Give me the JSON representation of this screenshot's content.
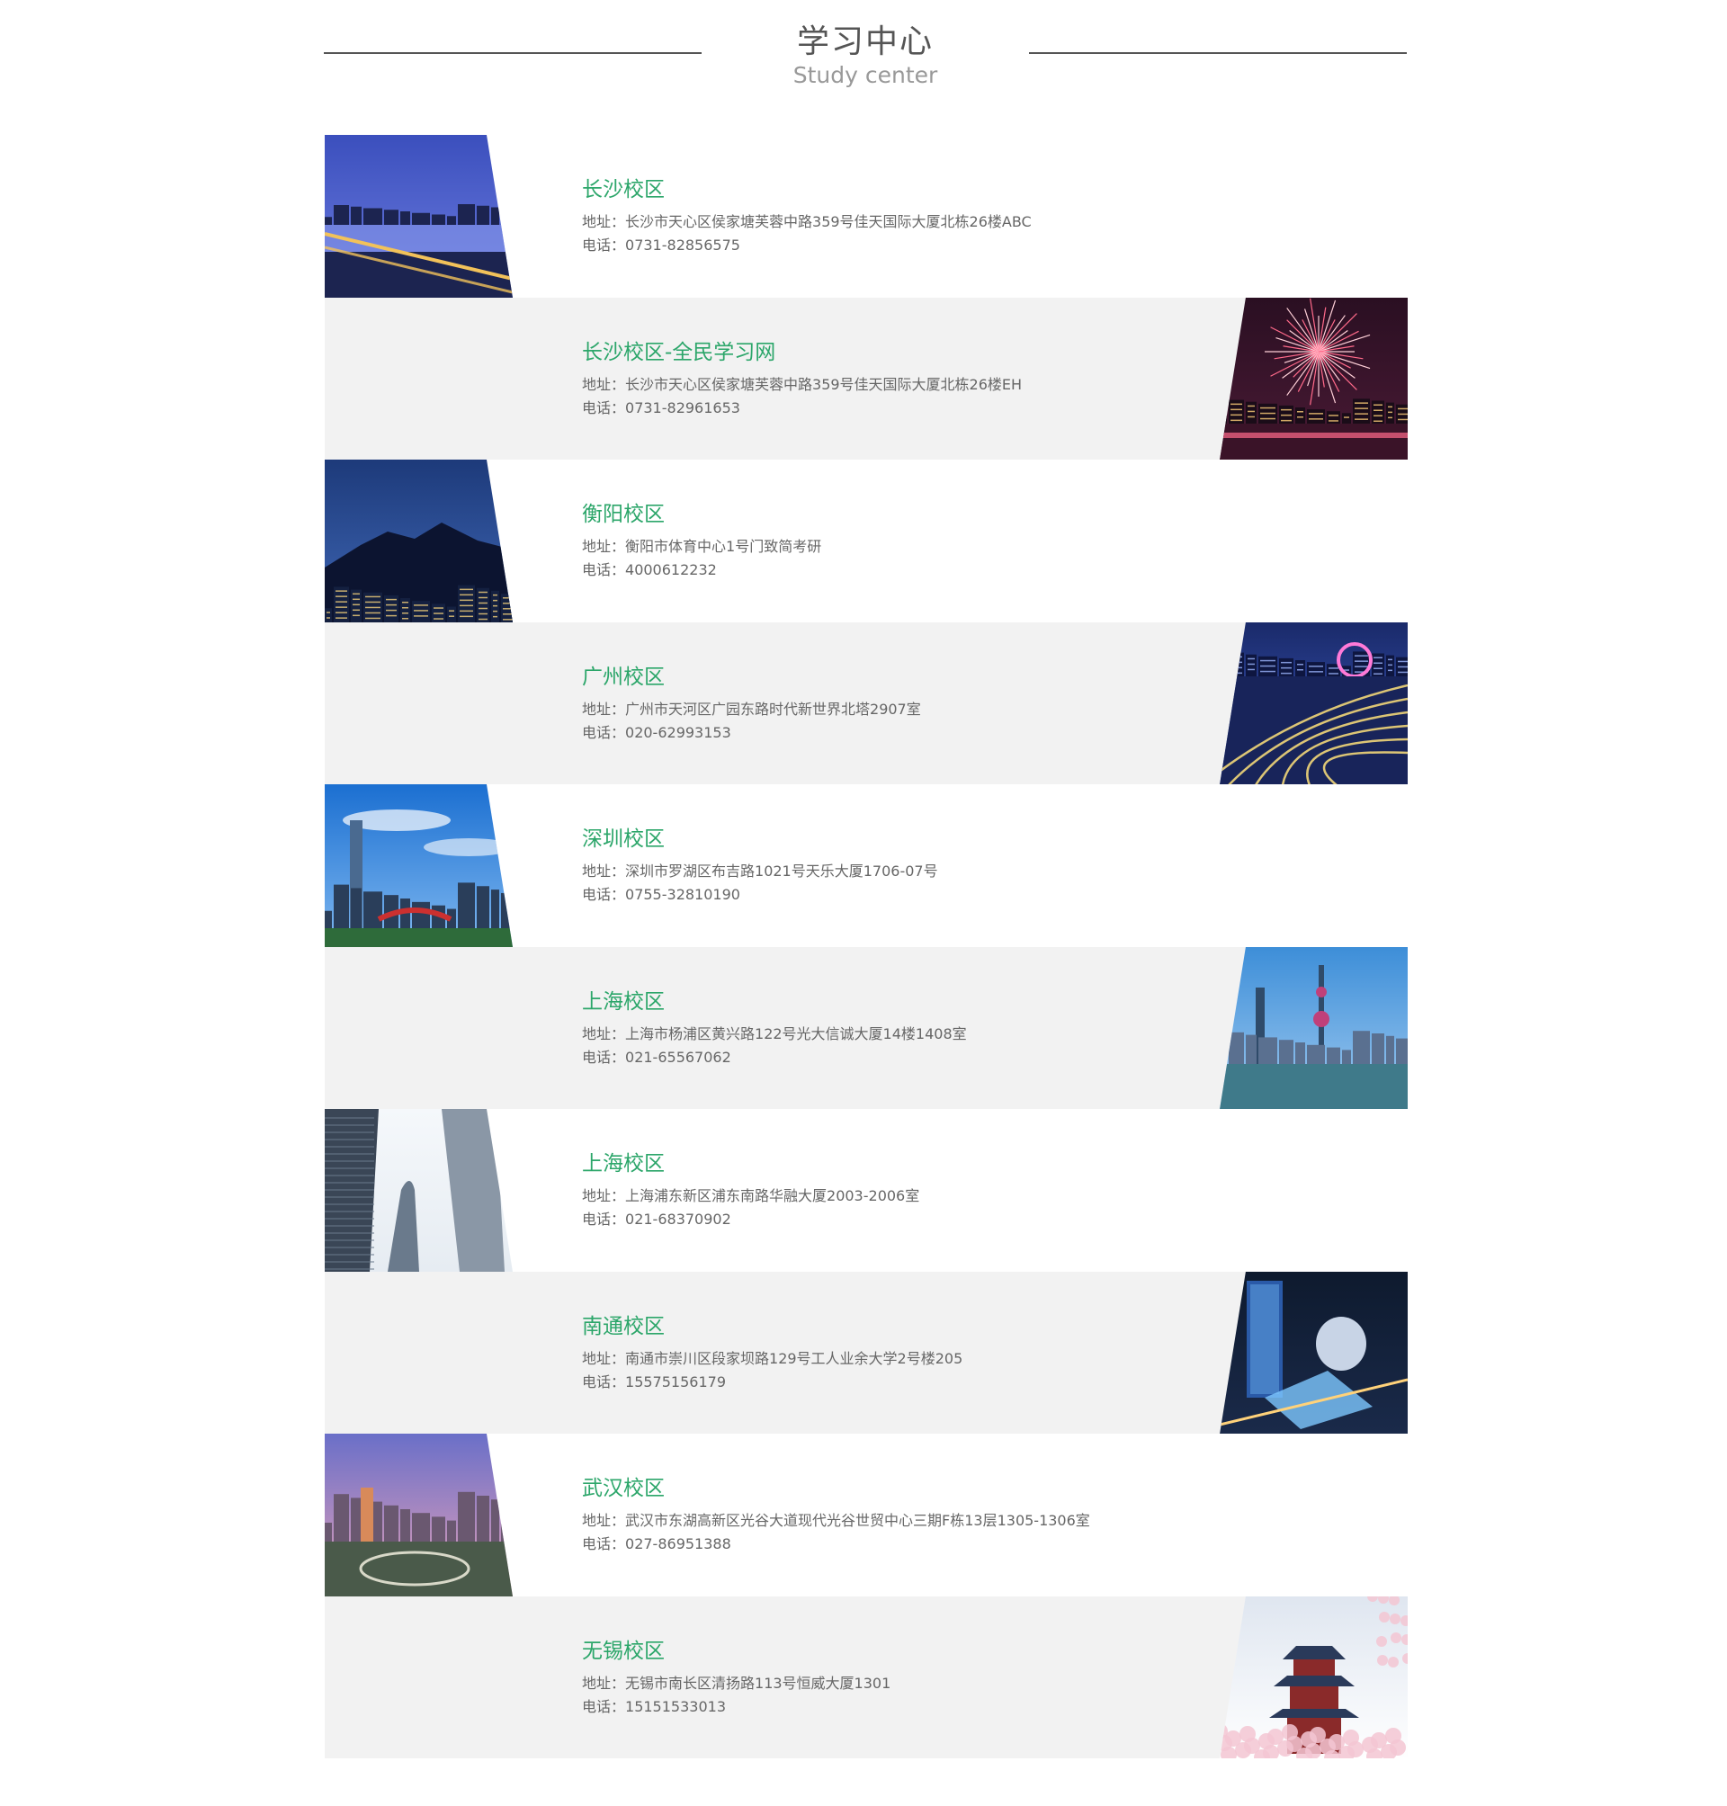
{
  "header": {
    "title_zh": "学习中心",
    "title_en": "Study center"
  },
  "campuses": [
    {
      "name": "长沙校区",
      "address_label": "地址：",
      "address": "长沙市天心区侯家塘芙蓉中路359号佳天国际大厦北栋26楼ABC",
      "phone_label": "电话：",
      "phone": "0731-82856575",
      "image_side": "left",
      "scene": "night-bridge",
      "palette": [
        "#3b4fbd",
        "#6d7de0",
        "#1c2450",
        "#f2c25a"
      ]
    },
    {
      "name": "长沙校区-全民学习网",
      "address_label": "地址：",
      "address": "长沙市天心区侯家塘芙蓉中路359号佳天国际大厦北栋26楼EH",
      "phone_label": "电话：",
      "phone": "0731-82961653",
      "image_side": "right",
      "scene": "fireworks",
      "palette": [
        "#2a0f22",
        "#4a1a35",
        "#ff6a8a",
        "#ffd0d8"
      ]
    },
    {
      "name": "衡阳校区",
      "address_label": "地址：",
      "address": "衡阳市体育中心1号门致简考研",
      "phone_label": "电话：",
      "phone": "4000612232",
      "image_side": "left",
      "scene": "night-mountain",
      "palette": [
        "#1d3a7a",
        "#3f67b5",
        "#0c1430",
        "#f5d27a"
      ]
    },
    {
      "name": "广州校区",
      "address_label": "地址：",
      "address": "广州市天河区广园东路时代新世界北塔2907室",
      "phone_label": "电话：",
      "phone": "020-62993153",
      "image_side": "right",
      "scene": "interchange",
      "palette": [
        "#1a2a6a",
        "#3d5bc2",
        "#ffe27a",
        "#ff7ad8"
      ]
    },
    {
      "name": "深圳校区",
      "address_label": "地址：",
      "address": "深圳市罗湖区布吉路1021号天乐大厦1706-07号",
      "phone_label": "电话：",
      "phone": "0755-32810190",
      "image_side": "left",
      "scene": "day-skyline",
      "palette": [
        "#1b6fd1",
        "#7fb8f0",
        "#2a3e5a",
        "#ffffff"
      ]
    },
    {
      "name": "上海校区",
      "address_label": "地址：",
      "address": "上海市杨浦区黄兴路122号光大信诚大厦14楼1408室",
      "phone_label": "电话：",
      "phone": "021-65567062",
      "image_side": "right",
      "scene": "bund",
      "palette": [
        "#3d8ed8",
        "#9fcaf0",
        "#2f4b6a",
        "#3f7a8a"
      ]
    },
    {
      "name": "上海校区",
      "address_label": "地址：",
      "address": "上海浦东新区浦东南路华融大厦2003-2006室",
      "phone_label": "电话：",
      "phone": "021-68370902",
      "image_side": "left",
      "scene": "towers-up",
      "palette": [
        "#e6ecf2",
        "#8a97a6",
        "#3a4656",
        "#c8d3de"
      ]
    },
    {
      "name": "南通校区",
      "address_label": "地址：",
      "address": "南通市崇川区段家坝路129号工人业余大学2号楼205",
      "phone_label": "电话：",
      "phone": "15575156179",
      "image_side": "right",
      "scene": "night-aerial",
      "palette": [
        "#0e1a2e",
        "#2a5aa8",
        "#7ec8ff",
        "#ffd27a"
      ]
    },
    {
      "name": "武汉校区",
      "address_label": "地址：",
      "address": "武汉市东湖高新区光谷大道现代光谷世贸中心三期F栋13层1305-1306室",
      "phone_label": "电话：",
      "phone": "027-86951388",
      "image_side": "left",
      "scene": "sunset-city",
      "palette": [
        "#6a6fc8",
        "#e8a2b8",
        "#4a5a4a",
        "#d88a5a"
      ]
    },
    {
      "name": "无锡校区",
      "address_label": "地址：",
      "address": "无锡市南长区清扬路113号恒威大厦1301",
      "phone_label": "电话：",
      "phone": "15151533013",
      "image_side": "right",
      "scene": "pagoda-blossom",
      "palette": [
        "#dfe6f0",
        "#f3c6d2",
        "#2a3a5a",
        "#8a2a2a"
      ]
    }
  ]
}
